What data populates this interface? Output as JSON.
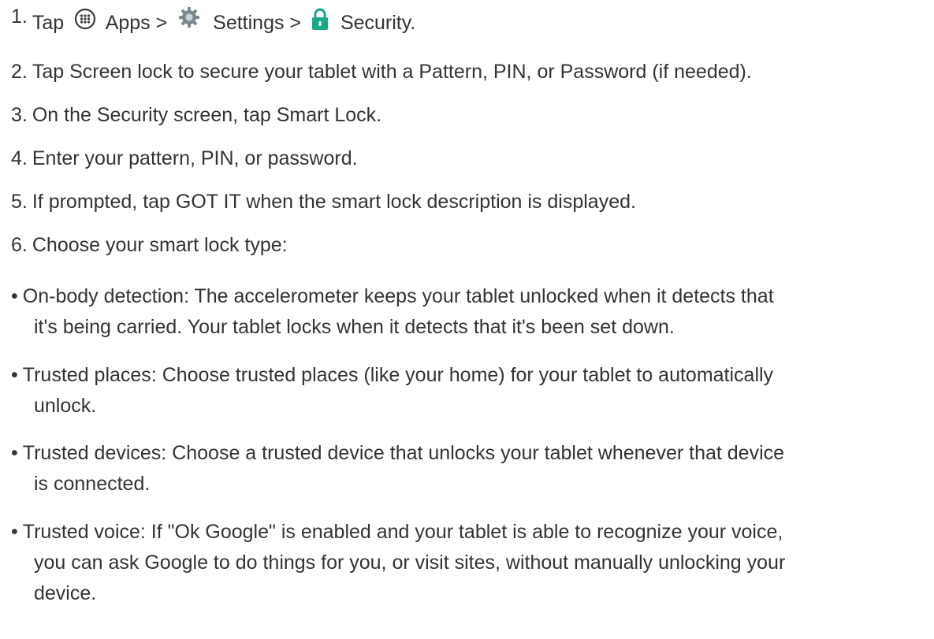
{
  "steps": [
    {
      "number": "1.",
      "parts": {
        "tap": "Tap",
        "apps": "Apps >",
        "settings": "Settings >",
        "security": "Security."
      },
      "icons": [
        "apps-icon",
        "gear-icon",
        "lock-icon"
      ]
    },
    {
      "number": "2.",
      "text": "Tap Screen lock to secure your tablet with a Pattern, PIN, or Password (if needed)."
    },
    {
      "number": "3.",
      "text": "On the Security screen, tap Smart Lock."
    },
    {
      "number": "4.",
      "text": "Enter your pattern, PIN, or password."
    },
    {
      "number": "5.",
      "text": "If prompted, tap GOT IT when the smart lock description is displayed."
    },
    {
      "number": "6.",
      "text": "Choose your smart lock type:"
    }
  ],
  "bullets": [
    {
      "symbol": "•",
      "lines": [
        "On-body detection: The accelerometer keeps your tablet unlocked when it detects that",
        "it's being carried. Your tablet locks when it detects that it's been set down."
      ]
    },
    {
      "symbol": "•",
      "lines": [
        "Trusted places: Choose trusted places (like your home) for your tablet to automatically",
        "unlock."
      ]
    },
    {
      "symbol": "•",
      "lines": [
        "Trusted devices: Choose a trusted device that unlocks your tablet whenever that device",
        "is connected."
      ]
    },
    {
      "symbol": "•",
      "lines": [
        "Trusted voice: If \"Ok Google\" is enabled and your tablet is able to recognize your voice,",
        "you can ask Google to do things for you, or visit sites, without manually unlocking your",
        "device."
      ]
    }
  ],
  "colors": {
    "text": "#333333",
    "apps_icon": "#3a3a3a",
    "gear_icon": "#7a8a8c",
    "lock_icon": "#17a88a"
  }
}
